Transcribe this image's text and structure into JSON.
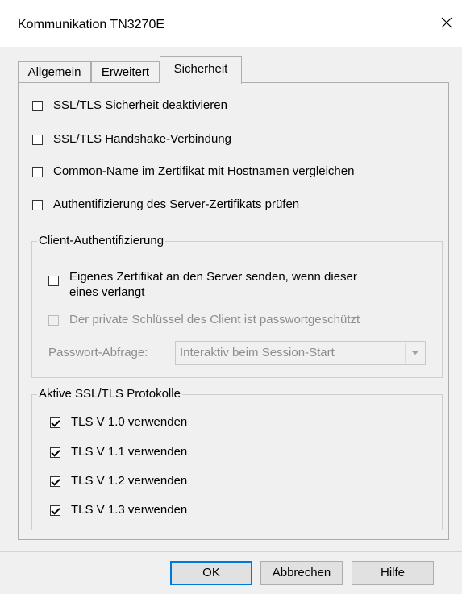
{
  "window": {
    "title": "Kommunikation TN3270E",
    "close_icon": "close-icon"
  },
  "tabs": [
    {
      "label": "Allgemein",
      "active": false
    },
    {
      "label": "Erweitert",
      "active": false
    },
    {
      "label": "Sicherheit",
      "active": true
    }
  ],
  "security": {
    "options": [
      {
        "label": "SSL/TLS Sicherheit deaktivieren",
        "checked": false
      },
      {
        "label": "SSL/TLS Handshake-Verbindung",
        "checked": false
      },
      {
        "label": "Common-Name im Zertifikat mit Hostnamen vergleichen",
        "checked": false
      },
      {
        "label": "Authentifizierung des Server-Zertifikats prüfen",
        "checked": false
      }
    ]
  },
  "client_auth": {
    "legend": "Client-Authentifizierung",
    "send_cert_line1": "Eigenes Zertifikat an den Server senden, wenn dieser",
    "send_cert_line2": "eines verlangt",
    "send_cert_checked": false,
    "private_key_label": "Der private Schlüssel des Client ist passwortgeschützt",
    "private_key_checked": false,
    "password_prompt_label": "Passwort-Abfrage:",
    "password_prompt_value": "Interaktiv beim Session-Start"
  },
  "protocols": {
    "legend": "Aktive SSL/TLS Protokolle",
    "items": [
      {
        "label": "TLS V 1.0 verwenden",
        "checked": true
      },
      {
        "label": "TLS V 1.1 verwenden",
        "checked": true
      },
      {
        "label": "TLS V 1.2 verwenden",
        "checked": true
      },
      {
        "label": "TLS V 1.3 verwenden",
        "checked": true
      }
    ]
  },
  "buttons": {
    "ok": "OK",
    "cancel": "Abbrechen",
    "help": "Hilfe"
  },
  "colors": {
    "focus_border": "#0078d7",
    "disabled_text": "#8d8d8d"
  }
}
